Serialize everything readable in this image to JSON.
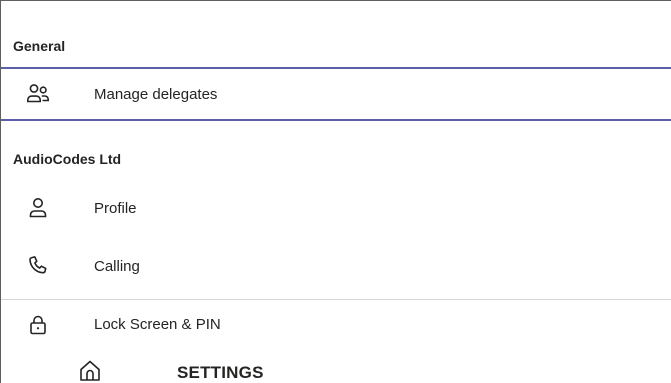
{
  "sections": [
    {
      "title": "General",
      "items": [
        {
          "label": "Manage delegates",
          "icon": "people-icon",
          "selected": true
        }
      ]
    },
    {
      "title": "AudioCodes Ltd",
      "items": [
        {
          "label": "Profile",
          "icon": "person-icon"
        },
        {
          "label": "Calling",
          "icon": "phone-icon"
        },
        {
          "label": "Lock Screen & PIN",
          "icon": "lock-icon"
        }
      ]
    }
  ],
  "bottom_bar": {
    "home_icon": "home-icon",
    "title": "SETTINGS"
  },
  "colors": {
    "selection_border": "#5b5fa8",
    "text": "#252423",
    "divider": "#d6d6d6"
  }
}
